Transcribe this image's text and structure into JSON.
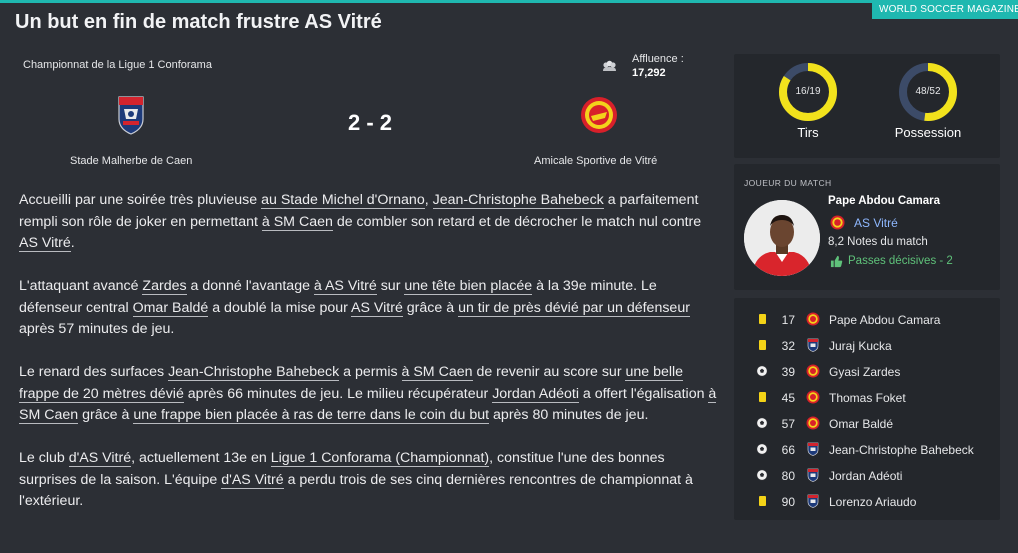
{
  "header": {
    "magazine": "WORLD SOCCER MAGAZINE",
    "title": "Un but en fin de match frustre AS Vitré"
  },
  "match": {
    "competition": "Championnat de la Ligue 1 Conforama",
    "attendance_label": "Affluence :",
    "attendance_value": "17,292",
    "score": "2 - 2",
    "home_stadium": "Stade Malherbe de Caen",
    "away_team": "Amicale Sportive de Vitré"
  },
  "article": {
    "p1": {
      "t1": "Accueilli par une soirée très pluvieuse ",
      "l1": "au Stade Michel d'Ornano",
      "t2": ", ",
      "l2": "Jean-Christophe Bahebeck",
      "t3": " a parfaitement rempli son rôle de joker en permettant ",
      "l3": "à SM Caen",
      "t4": " de combler son retard et de décrocher le match nul contre ",
      "l4": "AS Vitré",
      "t5": "."
    },
    "p2": {
      "t1": "L'attaquant avancé ",
      "l1": "Zardes",
      "t2": " a donné l'avantage ",
      "l2": "à AS Vitré",
      "t3": " sur ",
      "l3": "une tête bien placée",
      "t4": " à la 39e minute. Le défenseur central ",
      "l4": "Omar Baldé",
      "t5": " a doublé la mise pour ",
      "l5": "AS Vitré",
      "t6": " grâce à ",
      "l6": "un tir de près dévié par un défenseur",
      "t7": " après 57 minutes de jeu."
    },
    "p3": {
      "t1": "Le renard des surfaces ",
      "l1": "Jean-Christophe Bahebeck",
      "t2": " a permis ",
      "l2": "à SM Caen",
      "t3": " de revenir au score sur ",
      "l3": "une belle frappe de 20 mètres dévié",
      "t4": " après 66 minutes de jeu. Le milieu récupérateur ",
      "l4": "Jordan Adéoti",
      "t5": " a offert l'égalisation ",
      "l5": "à SM Caen",
      "t6": " grâce à ",
      "l6": "une frappe bien placée à ras de terre dans le coin du but",
      "t7": " après 80 minutes de jeu."
    },
    "p4": {
      "t1": "Le club ",
      "l1": "d'AS Vitré",
      "t2": ", actuellement 13e en ",
      "l2": "Ligue 1 Conforama (Championnat)",
      "t3": ", constitue l'une des bonnes surprises de la saison. L'équipe ",
      "l3": "d'AS Vitré",
      "t4": " a perdu trois de ses cinq dernières rencontres de championnat à l'extérieur."
    }
  },
  "stats": {
    "shots": {
      "value": "16/19",
      "label": "Tirs",
      "fraction": 0.842
    },
    "possession": {
      "value": "48/52",
      "label": "Possession",
      "fraction": 0.52
    },
    "ring_color": "#f2e21c",
    "ring_bg": "#3c4b68"
  },
  "man_of_match": {
    "title": "JOUEUR DU MATCH",
    "name": "Pape Abdou Camara",
    "club": "AS Vitré",
    "rating": "8,2 Notes du match",
    "assists": "Passes décisives - 2"
  },
  "events": [
    {
      "type": "yellow-card",
      "minute": "17",
      "team": "vitre",
      "player": "Pape Abdou Camara"
    },
    {
      "type": "yellow-card",
      "minute": "32",
      "team": "caen",
      "player": "Juraj Kucka"
    },
    {
      "type": "goal",
      "minute": "39",
      "team": "vitre",
      "player": "Gyasi Zardes"
    },
    {
      "type": "yellow-card",
      "minute": "45",
      "team": "vitre",
      "player": "Thomas Foket"
    },
    {
      "type": "goal",
      "minute": "57",
      "team": "vitre",
      "player": "Omar Baldé"
    },
    {
      "type": "goal",
      "minute": "66",
      "team": "caen",
      "player": "Jean-Christophe Bahebeck"
    },
    {
      "type": "goal",
      "minute": "80",
      "team": "caen",
      "player": "Jordan Adéoti"
    },
    {
      "type": "yellow-card",
      "minute": "90",
      "team": "caen",
      "player": "Lorenzo Ariaudo"
    }
  ]
}
